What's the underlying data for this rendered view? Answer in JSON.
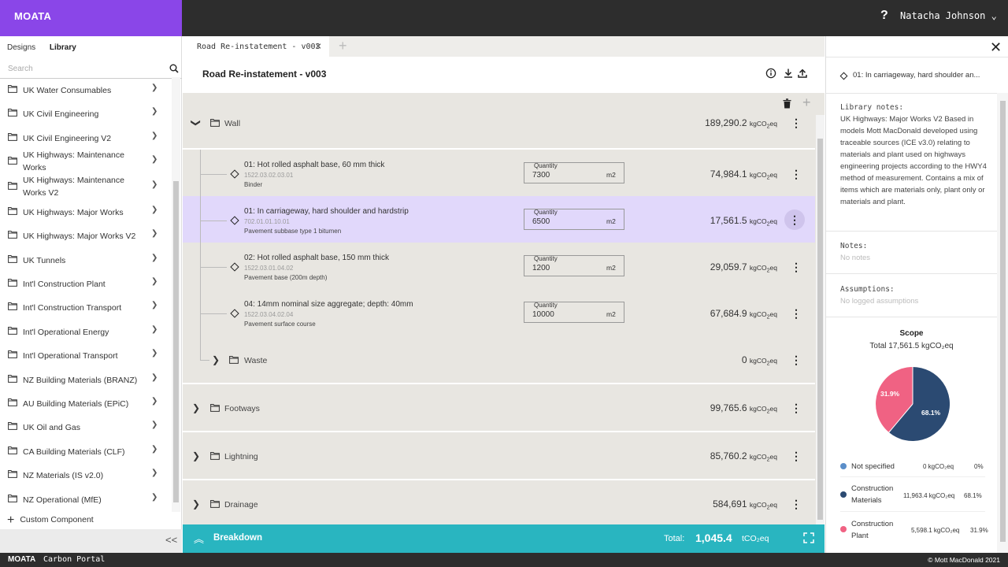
{
  "app": {
    "logo": "MOATA",
    "help": "?",
    "user": "Natacha Johnson ⌄"
  },
  "sidebar": {
    "tabs": [
      "Designs",
      "Library"
    ],
    "search_placeholder": "Search",
    "items": [
      "UK Water Consumables",
      "UK Civil Engineering",
      "UK Civil Engineering V2",
      "UK Highways: Maintenance Works",
      "UK Highways: Maintenance Works V2",
      "UK Highways: Major Works",
      "UK Highways: Major Works V2",
      "UK Tunnels",
      "Int'l Construction Plant",
      "Int'l Construction Transport",
      "Int'l Operational Energy",
      "Int'l Operational Transport",
      "NZ Building Materials (BRANZ)",
      "AU Building Materials (EPiC)",
      "UK Oil and Gas",
      "CA Building Materials (CLF)",
      "NZ Materials (IS v2.0)",
      "NZ Operational (MfE)"
    ],
    "custom_component": "Custom Component",
    "collapse": "<<"
  },
  "main": {
    "tab_label": "Road Re-instatement - v003",
    "title": "Road Re-instatement - v003",
    "unit": "kgCO",
    "unit_sub": "2",
    "unit_tail": "eq",
    "groups": {
      "wall": {
        "name": "Wall",
        "value": "189,290.2"
      },
      "waste": {
        "name": "Waste",
        "value": "0"
      },
      "footways": {
        "name": "Footways",
        "value": "99,765.6"
      },
      "lightning": {
        "name": "Lightning",
        "value": "85,760.2"
      },
      "drainage": {
        "name": "Drainage",
        "value": "584,691"
      }
    },
    "quantity_label": "Quantity",
    "items": [
      {
        "name": "01: Hot rolled asphalt base, 60 mm thick",
        "code": "1522.03.02.03.01",
        "sub": "Binder",
        "qty": "7300",
        "unit": "m2",
        "value": "74,984.1"
      },
      {
        "name": "01: In carriageway, hard shoulder and hardstrip",
        "code": "702.01.01.10.01",
        "sub": "Pavement subbase type 1 bitumen",
        "qty": "6500",
        "unit": "m2",
        "value": "17,561.5"
      },
      {
        "name": "02: Hot rolled asphalt base, 150 mm thick",
        "code": "1522.03.01.04.02",
        "sub": "Pavement base (200m depth)",
        "qty": "1200",
        "unit": "m2",
        "value": "29,059.7"
      },
      {
        "name": "04: 14mm nominal size aggregate; depth: 40mm",
        "code": "1522.03.04.02.04",
        "sub": "Pavement surface course",
        "qty": "10000",
        "unit": "m2",
        "value": "67,684.9"
      }
    ],
    "breakdown": {
      "label": "Breakdown",
      "total_label": "Total:",
      "total_value": "1,045.4",
      "total_unit": "tCO₂eq"
    }
  },
  "panel": {
    "title": "01: In carriageway, hard shoulder an...",
    "library_notes_label": "Library notes:",
    "library_notes": "UK Highways: Major Works V2 Based in models Mott MacDonald developed using traceable sources (ICE v3.0) relating to materials and plant used on highways engineering projects according to the HWY4 method of measurement. Contains a mix of items which are materials only, plant only or materials and plant.",
    "notes_label": "Notes:",
    "notes": "No notes",
    "assumptions_label": "Assumptions:",
    "assumptions": "No logged assumptions",
    "scope_title": "Scope",
    "scope_total": "Total 17,561.5 kgCO₂eq",
    "legend": [
      {
        "name": "Not specified",
        "value": "0 kgCO₂eq",
        "pct": "0%",
        "color": "#5b8ec9"
      },
      {
        "name": "Construction Materials",
        "value": "11,963.4 kgCO₂eq",
        "pct": "68.1%",
        "color": "#2b4a72"
      },
      {
        "name": "Construction Plant",
        "value": "5,598.1 kgCO₂eq",
        "pct": "31.9%",
        "color": "#f06283"
      }
    ],
    "pie_labels": {
      "materials": "68.1%",
      "plant": "31.9%"
    }
  },
  "footer": {
    "brand": "MOATA",
    "portal": "Carbon Portal",
    "copyright": "© Mott MacDonald 2021"
  }
}
